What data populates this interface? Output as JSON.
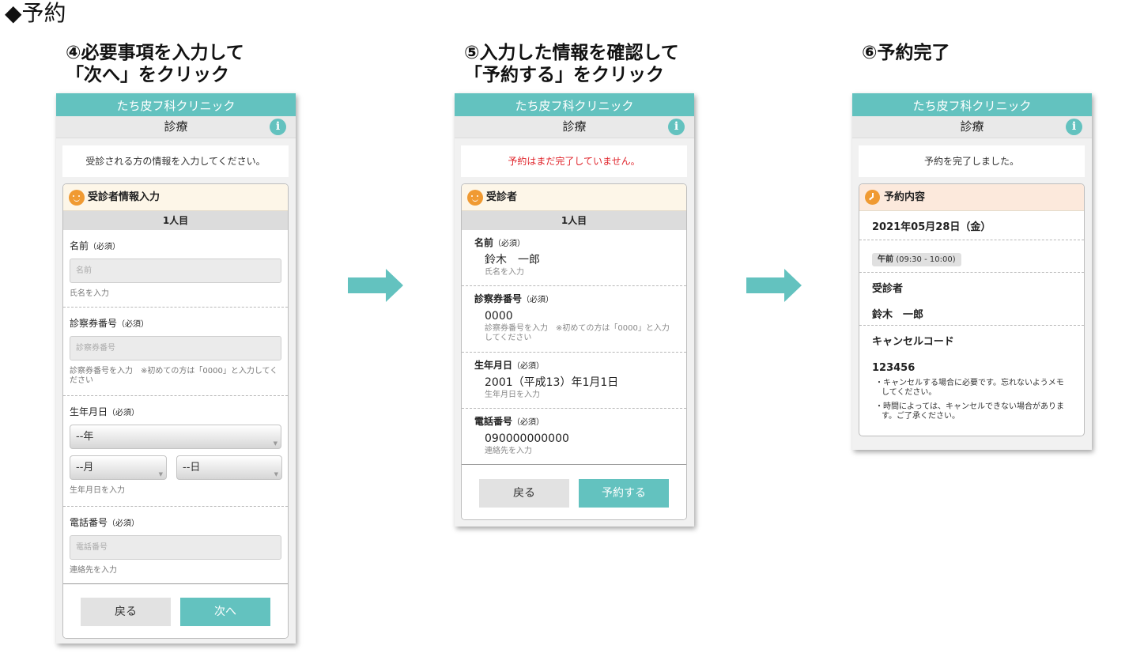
{
  "section_title": "◆予約",
  "steps": [
    {
      "line1": "④必要事項を入力して",
      "line2": "「次へ」をクリック"
    },
    {
      "line1": "⑤入力した情報を確認して",
      "line2": "「予約する」をクリック"
    },
    {
      "line1": "⑥予約完了"
    }
  ],
  "clinic_name": "たち皮フ科クリニック",
  "sub_title": "診療",
  "info_icon_glyph": "i",
  "brand_color": "#63c2bf",
  "accent_color": "#f09a32",
  "screen1": {
    "notice": "受診される方の情報を入力してください。",
    "card_title": "受診者情報入力",
    "person_label": "1人目",
    "name": {
      "label": "名前",
      "req": "（必須）",
      "placeholder": "名前",
      "hint": "氏名を入力"
    },
    "card_no": {
      "label": "診察券番号",
      "req": "（必須）",
      "placeholder": "診察券番号",
      "hint": "診察券番号を入力　※初めての方は「0000」と入力してください"
    },
    "birthday": {
      "label": "生年月日",
      "req": "（必須）",
      "year": "--年",
      "month": "--月",
      "day": "--日",
      "hint": "生年月日を入力"
    },
    "phone": {
      "label": "電話番号",
      "req": "（必須）",
      "placeholder": "電話番号",
      "hint": "連絡先を入力"
    },
    "back": "戻る",
    "next": "次へ"
  },
  "screen2": {
    "notice": "予約はまだ完了していません。",
    "notice_color": "#e0242b",
    "card_title": "受診者",
    "person_label": "1人目",
    "fields": [
      {
        "label": "名前",
        "req": "（必須）",
        "value": "鈴木　一郎",
        "hint": "氏名を入力"
      },
      {
        "label": "診察券番号",
        "req": "（必須）",
        "value": "0000",
        "hint": "診察券番号を入力　※初めての方は「0000」と入力してください"
      },
      {
        "label": "生年月日",
        "req": "（必須）",
        "value": "2001（平成13）年1月1日",
        "hint": "生年月日を入力"
      },
      {
        "label": "電話番号",
        "req": "（必須）",
        "value": "090000000000",
        "hint": "連絡先を入力"
      }
    ],
    "back": "戻る",
    "submit": "予約する"
  },
  "screen3": {
    "notice": "予約を完了しました。",
    "card_title": "予約内容",
    "date": "2021年05月28日（金）",
    "slot_period": "午前",
    "slot_time": "(09:30 - 10:00)",
    "patient_label": "受診者",
    "patient_name": "鈴木　一郎",
    "cancel_label": "キャンセルコード",
    "cancel_code": "123456",
    "notes": [
      "・キャンセルする場合に必要です。忘れないようメモしてください。",
      "・時間によっては、キャンセルできない場合があります。ご了承ください。"
    ]
  }
}
